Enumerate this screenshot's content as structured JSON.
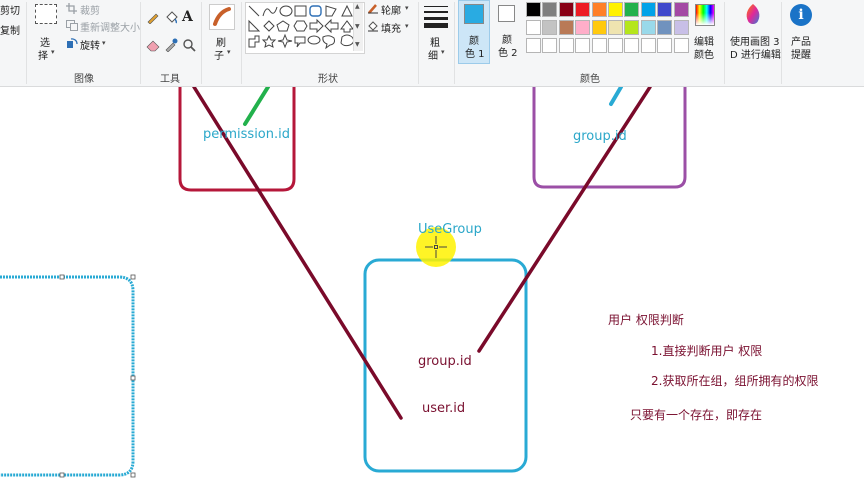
{
  "ribbon": {
    "clipboard": {
      "cut": "剪切",
      "copy": "复制"
    },
    "image": {
      "select_line1": "选",
      "select_line2": "择",
      "crop": "裁剪",
      "resize": "重新调整大小",
      "rotate": "旋转",
      "group_label": "图像"
    },
    "tools": {
      "text_tool": "A",
      "group_label": "工具"
    },
    "brushes": {
      "line1": "刷",
      "line2": "子"
    },
    "shapes": {
      "outline": "轮廓",
      "fill": "填充",
      "group_label": "形状"
    },
    "size": {
      "line1": "粗",
      "line2": "细"
    },
    "color1": {
      "line1": "颜",
      "line2": "色 1",
      "value": "#29abe2"
    },
    "color2": {
      "line1": "颜",
      "line2": "色 2",
      "value": "#ffffff"
    },
    "palette": {
      "row1": [
        "#000000",
        "#7f7f7f",
        "#880015",
        "#ed1c24",
        "#ff7f27",
        "#fff200",
        "#22b14c",
        "#00a2e8",
        "#3f48cc",
        "#a349a4"
      ],
      "row2": [
        "#ffffff",
        "#c3c3c3",
        "#b97a57",
        "#ffaec9",
        "#ffc90e",
        "#efe4b0",
        "#b5e61d",
        "#99d9ea",
        "#7092be",
        "#c8bfe7"
      ],
      "group_label": "颜色"
    },
    "edit_colors": {
      "line1": "编辑",
      "line2": "颜色"
    },
    "paint3d": {
      "line1": "使用画图 3",
      "line2": "D 进行编辑"
    },
    "product_alert": {
      "line1": "产品",
      "line2": "提醒"
    }
  },
  "canvas": {
    "permission_label": "permission.id",
    "group_top_label": "group.id",
    "usegroup_label": "UseGroup",
    "usergroup_group_id": "group.id",
    "usergroup_user_id": "user.id",
    "note_title": "用户 权限判断",
    "note_1": "1.直接判断用户 权限",
    "note_2": "2.获取所在组，组所拥有的权限",
    "note_3": "只要有一个存在，即存在",
    "colors": {
      "permission_box": "#b5173a",
      "group_box": "#9b4fa6",
      "usergroup_box": "#29aad4",
      "selection_box": "#29aad4",
      "connector": "#7a0a2a",
      "green_stroke": "#22b14c",
      "cyan_stroke": "#29aad4",
      "label_cyan": "#2ba7c9",
      "label_maroon": "#7a1030",
      "cursor_highlight": "#fff200"
    }
  }
}
